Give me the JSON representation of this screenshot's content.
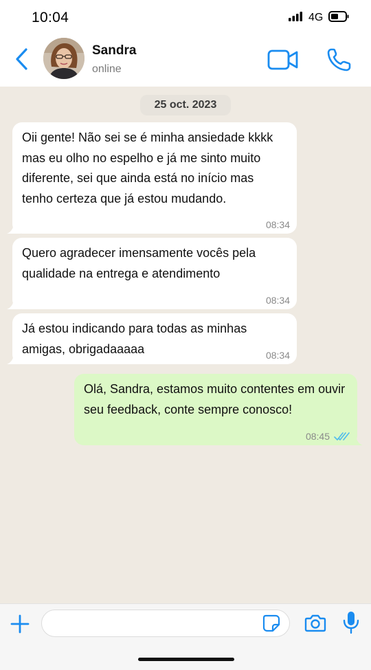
{
  "status_bar": {
    "time": "10:04",
    "network": "4G",
    "icons": [
      "signal-icon",
      "battery-icon"
    ]
  },
  "header": {
    "contact_name": "Sandra",
    "contact_status": "online",
    "icons": [
      "chevron-left-icon",
      "video-camera-icon",
      "phone-icon"
    ],
    "accent_color": "#1a8cf0"
  },
  "chat": {
    "date_label": "25 oct. 2023",
    "messages": [
      {
        "direction": "incoming",
        "text": "Oii gente! Não sei se é minha ansiedade kkkk mas eu olho no espelho e já me sinto muito diferente, sei que ainda está no início mas tenho certeza que já estou mudando.",
        "time": "08:34"
      },
      {
        "direction": "incoming",
        "text": "Quero agradecer imensamente vocês pela qualidade na entrega e atendimento",
        "time": "08:34"
      },
      {
        "direction": "incoming",
        "text": "Já estou indicando para todas as minhas amigas, obrigadaaaaa",
        "time": "08:34"
      },
      {
        "direction": "outgoing",
        "text": "Olá, Sandra, estamos muito contentes em ouvir seu feedback, conte sempre conosco!",
        "time": "08:45",
        "status": "read"
      }
    ],
    "colors": {
      "background": "#efeae2",
      "incoming_bubble": "#ffffff",
      "outgoing_bubble": "#dcf8c6",
      "read_receipt": "#53bdeb"
    }
  },
  "input_bar": {
    "message_value": "",
    "icons": [
      "plus-icon",
      "sticker-icon",
      "camera-icon",
      "microphone-icon"
    ]
  }
}
